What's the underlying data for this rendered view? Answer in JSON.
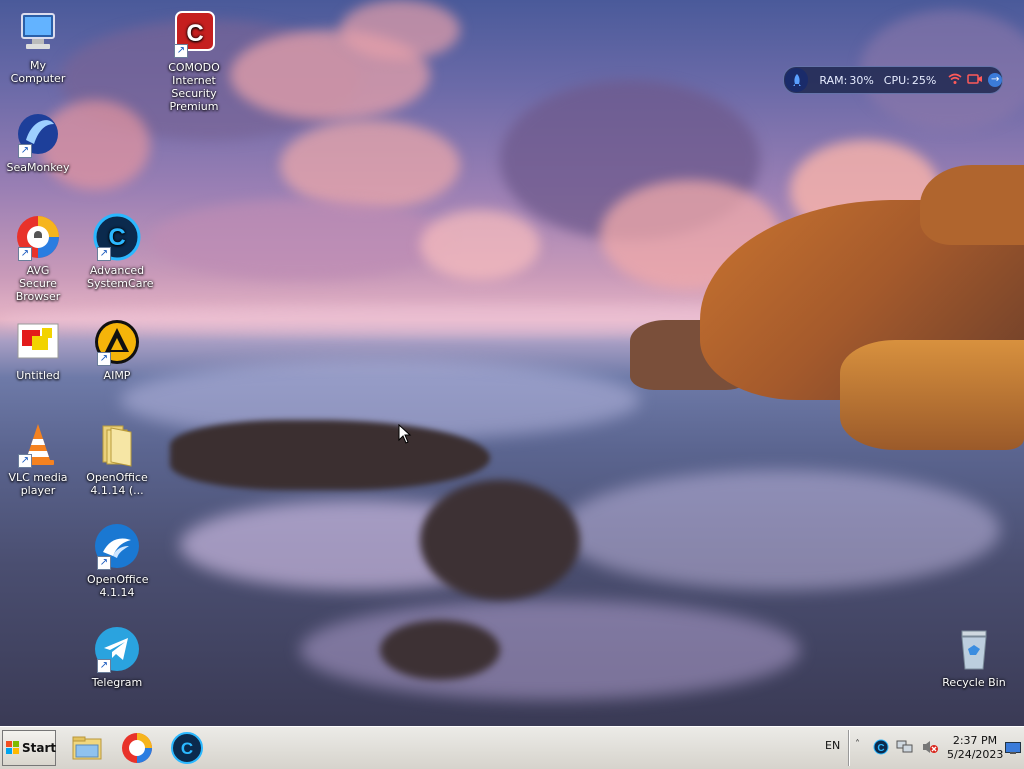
{
  "desktop": {
    "icons": [
      {
        "id": "my-computer",
        "label": "My Computer",
        "shortcut": false
      },
      {
        "id": "comodo",
        "label": "COMODO Internet Security Premium",
        "shortcut": true
      },
      {
        "id": "seamonkey",
        "label": "SeaMonkey",
        "shortcut": true
      },
      {
        "id": "avg",
        "label": "AVG Secure Browser",
        "shortcut": true
      },
      {
        "id": "asc",
        "label": "Advanced SystemCare",
        "shortcut": true
      },
      {
        "id": "untitled",
        "label": "Untitled",
        "shortcut": false
      },
      {
        "id": "aimp",
        "label": "AIMP",
        "shortcut": true
      },
      {
        "id": "vlc",
        "label": "VLC media player",
        "shortcut": true
      },
      {
        "id": "oo-folder",
        "label": "OpenOffice 4.1.14 (...",
        "shortcut": false
      },
      {
        "id": "oo-app",
        "label": "OpenOffice 4.1.14",
        "shortcut": true
      },
      {
        "id": "telegram",
        "label": "Telegram",
        "shortcut": true
      },
      {
        "id": "recycle",
        "label": "Recycle Bin",
        "shortcut": false
      }
    ]
  },
  "monitor": {
    "ram_label": "RAM:",
    "ram_value": "30%",
    "cpu_label": "CPU:",
    "cpu_value": "25%",
    "colors": {
      "accent": "#5aa0ff",
      "alert": "#ff5a5a"
    }
  },
  "taskbar": {
    "start_label": "Start",
    "pinned": [
      "file-explorer-icon",
      "avg-browser-icon",
      "advanced-systemcare-icon"
    ],
    "lang": "EN",
    "clock_time": "2:37 PM",
    "clock_date": "5/24/2023"
  }
}
